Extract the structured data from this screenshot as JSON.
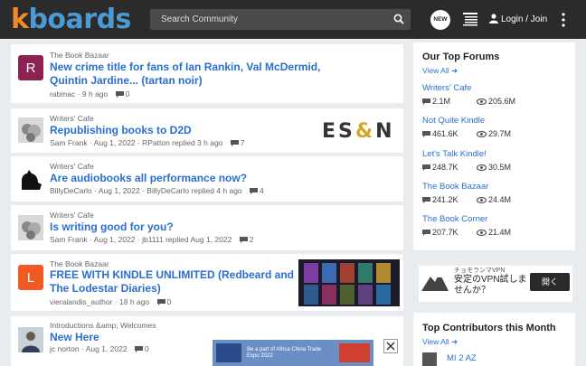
{
  "header": {
    "logo_k": "k",
    "logo_rest": "boards",
    "search_placeholder": "Search Community",
    "new_badge": "NEW",
    "login_label": "Login / Join"
  },
  "feed": [
    {
      "forum": "The Book Bazaar",
      "title": "New crime title for fans of Ian Rankin, Val McDermid, Quintin Jardine... (tartan noir)",
      "author": "rabmac",
      "time": "9 h ago",
      "replies": "0",
      "avatar_letter": "R",
      "avatar_color": "#8b2252"
    },
    {
      "forum": "Writers' Cafe",
      "title": "Republishing books to D2D",
      "author": "Sam Frank",
      "time": "Aug 1, 2022",
      "reply_info": "RPatton replied 3 h ago",
      "replies": "7"
    },
    {
      "forum": "Writers' Cafe",
      "title": "Are audiobooks all performance now?",
      "author": "BillyDeCarlo",
      "time": "Aug 1, 2022",
      "reply_info": "BillyDeCarlo replied 4 h ago",
      "replies": "4"
    },
    {
      "forum": "Writers' Cafe",
      "title": "Is writing good for you?",
      "author": "Sam Frank",
      "time": "Aug 1, 2022",
      "reply_info": "jb1111 replied Aug 1, 2022",
      "replies": "2"
    },
    {
      "forum": "The Book Bazaar",
      "title": "FREE WITH KINDLE UNLIMITED (Redbeard and The Lodestar Diaries)",
      "author": "vieralandis_author",
      "time": "18 h ago",
      "replies": "0",
      "avatar_letter": "L",
      "avatar_color": "#f15a22"
    },
    {
      "forum": "Introductions &amp; Welcomes",
      "title": "New Here",
      "author": "jc norton",
      "time": "Aug 1, 2022",
      "replies": "0"
    }
  ],
  "top_forums": {
    "heading": "Our Top Forums",
    "view_all": "View All ➜",
    "items": [
      {
        "name": "Writers' Cafe",
        "posts": "2.1M",
        "views": "205.6M"
      },
      {
        "name": "Not Quite Kindle",
        "posts": "461.6K",
        "views": "29.7M"
      },
      {
        "name": "Let's Talk Kindle!",
        "posts": "248.7K",
        "views": "30.5M"
      },
      {
        "name": "The Book Bazaar",
        "posts": "241.2K",
        "views": "24.4M"
      },
      {
        "name": "The Book Corner",
        "posts": "207.7K",
        "views": "21.4M"
      }
    ]
  },
  "ad": {
    "line1": "チョモランマVPN",
    "line2": "安定のVPN試しませんか？",
    "button": "開く"
  },
  "esn": {
    "left": "ES",
    "amp": "&",
    "right": "N"
  },
  "contributors": {
    "heading": "Top Contributors this Month",
    "view_all": "View All ➜",
    "first": "MI 2 AZ"
  },
  "bottom_ad": {
    "text": "Be a part of Africa China Trade Expo 2022"
  },
  "colors": {
    "accent": "#2a6fcf",
    "header_bg": "#2b2b2b",
    "logo_orange": "#f08a2a",
    "logo_blue": "#4a9bd3"
  }
}
